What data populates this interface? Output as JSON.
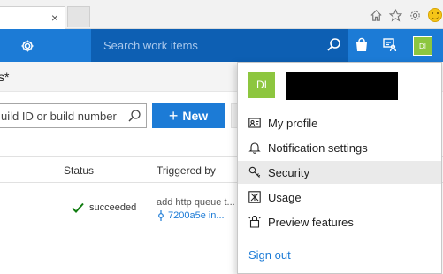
{
  "browser": {
    "tab_close_glyph": "×"
  },
  "navbar": {
    "search_placeholder": "Search work items",
    "avatar_initials": "DI",
    "bar_color": "#1c7bd6",
    "search_bg_color": "#0d5fb3"
  },
  "page": {
    "title_fragment": "s*",
    "filter_placeholder": "uild ID or build number",
    "new_button_label": "New",
    "new_button_plus": "+"
  },
  "table": {
    "columns": {
      "status": "Status",
      "triggered_by": "Triggered by"
    },
    "rows": [
      {
        "status": "succeeded",
        "trigger_text": "add http queue t...",
        "commit": "7200a5e",
        "commit_suffix": " in..."
      }
    ]
  },
  "profile_menu": {
    "avatar_initials": "DI",
    "avatar_color": "#8dc63f",
    "items": [
      {
        "label": "My profile",
        "icon": "profile-card-icon"
      },
      {
        "label": "Notification settings",
        "icon": "bell-icon"
      },
      {
        "label": "Security",
        "icon": "key-icon"
      },
      {
        "label": "Usage",
        "icon": "usage-icon"
      },
      {
        "label": "Preview features",
        "icon": "preview-features-icon"
      }
    ],
    "sign_out_label": "Sign out"
  }
}
